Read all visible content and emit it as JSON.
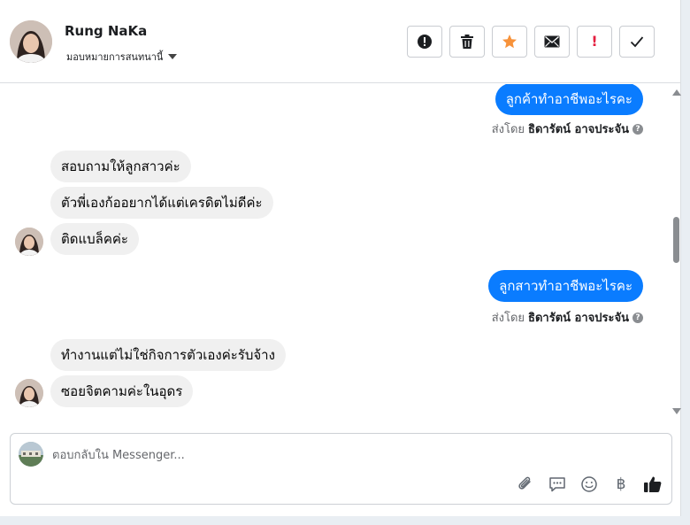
{
  "header": {
    "name": "Rung NaKa",
    "assign_label": "มอบหมายการสนทนานี้",
    "toolbar": [
      {
        "icon": "spam-icon"
      },
      {
        "icon": "trash-icon"
      },
      {
        "icon": "star-icon",
        "color": "#f7923a"
      },
      {
        "icon": "mail-icon"
      },
      {
        "icon": "important-icon",
        "glyph": "!",
        "color": "#e41e3f"
      },
      {
        "icon": "check-icon"
      }
    ]
  },
  "messages": {
    "out_1": "ลูกค้าทำอาชีพอะไรคะ",
    "sent_by_prefix": "ส่งโดย",
    "sent_by_name": "ธิดารัตน์ อาจประจัน",
    "in_1": "สอบถามให้ลูกสาวค่ะ",
    "in_2": "ตัวพี่เองก้ออยากได้แต่เครดิตไม่ดีค่ะ",
    "in_3": "ติดแบล็คค่ะ",
    "out_2": "ลูกสาวทำอาชีพอะไรคะ",
    "in_4": "ทำงานแต่ไม่ใช่กิจการตัวเองค่ะรับจ้าง",
    "in_5": "ซอยจิตคามค่ะในอุดร",
    "qmark": "?"
  },
  "composer": {
    "placeholder": "ตอบกลับใน Messenger...",
    "baht_glyph": "฿"
  },
  "colors": {
    "outgoing": "#0a7cff",
    "incoming": "#f0f0f0"
  }
}
